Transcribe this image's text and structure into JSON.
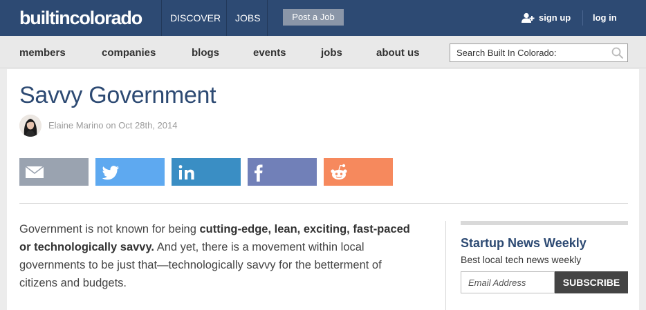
{
  "header": {
    "logo": "builtincolorado",
    "nav": [
      "DISCOVER",
      "JOBS"
    ],
    "post_job": "Post a Job",
    "sign_up": "sign up",
    "log_in": "log in",
    "colors": {
      "bar": "#2d4a73",
      "post_button": "#8a96a8"
    }
  },
  "subnav": {
    "items": [
      "members",
      "companies",
      "blogs",
      "events",
      "jobs",
      "about us"
    ],
    "search_placeholder": "Search Built In Colorado:"
  },
  "article": {
    "title": "Savvy Government",
    "byline": "Elaine Marino on Oct 28th, 2014",
    "intro_1": "Government is not known for being ",
    "intro_bold": "cutting-edge, lean, exciting, fast-paced or technologically savvy.",
    "intro_2": " And yet, there is a movement within local governments to be just that—technologically savvy for the betterment of citizens and budgets."
  },
  "share": [
    {
      "name": "email",
      "icon": "envelope-icon",
      "color": "#9aa3b0"
    },
    {
      "name": "twitter",
      "icon": "twitter-bird-icon",
      "color": "#5ea9f0"
    },
    {
      "name": "linkedin",
      "icon": "linkedin-icon",
      "color": "#3a8ec4"
    },
    {
      "name": "facebook",
      "icon": "facebook-icon",
      "color": "#7180b8"
    },
    {
      "name": "reddit",
      "icon": "reddit-alien-icon",
      "color": "#f6895d"
    }
  ],
  "sidebar": {
    "title": "Startup News Weekly",
    "subtitle": "Best local tech news weekly",
    "email_placeholder": "Email Address",
    "subscribe": "SUBSCRIBE"
  }
}
